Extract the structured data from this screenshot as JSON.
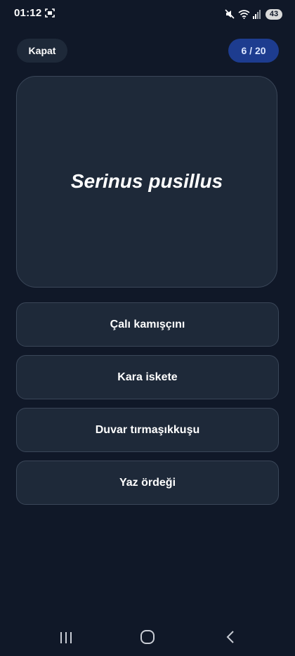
{
  "status_bar": {
    "time": "01:12",
    "battery": "43",
    "icons": [
      "screenshot-icon",
      "mute-icon",
      "wifi-icon",
      "signal-icon",
      "battery-icon"
    ]
  },
  "header": {
    "close_label": "Kapat",
    "progress": "6 / 20"
  },
  "question": {
    "text": "Serinus pusillus"
  },
  "answers": [
    {
      "label": "Çalı kamışçını"
    },
    {
      "label": "Kara iskete"
    },
    {
      "label": "Duvar tırmaşıkkuşu"
    },
    {
      "label": "Yaz ördeği"
    }
  ],
  "nav_bar": {
    "icons": [
      "recent-apps-icon",
      "home-icon",
      "back-icon"
    ]
  },
  "colors": {
    "background": "#101828",
    "card": "#1e2939",
    "border": "#3a4658",
    "accent": "#1d3c8f"
  }
}
